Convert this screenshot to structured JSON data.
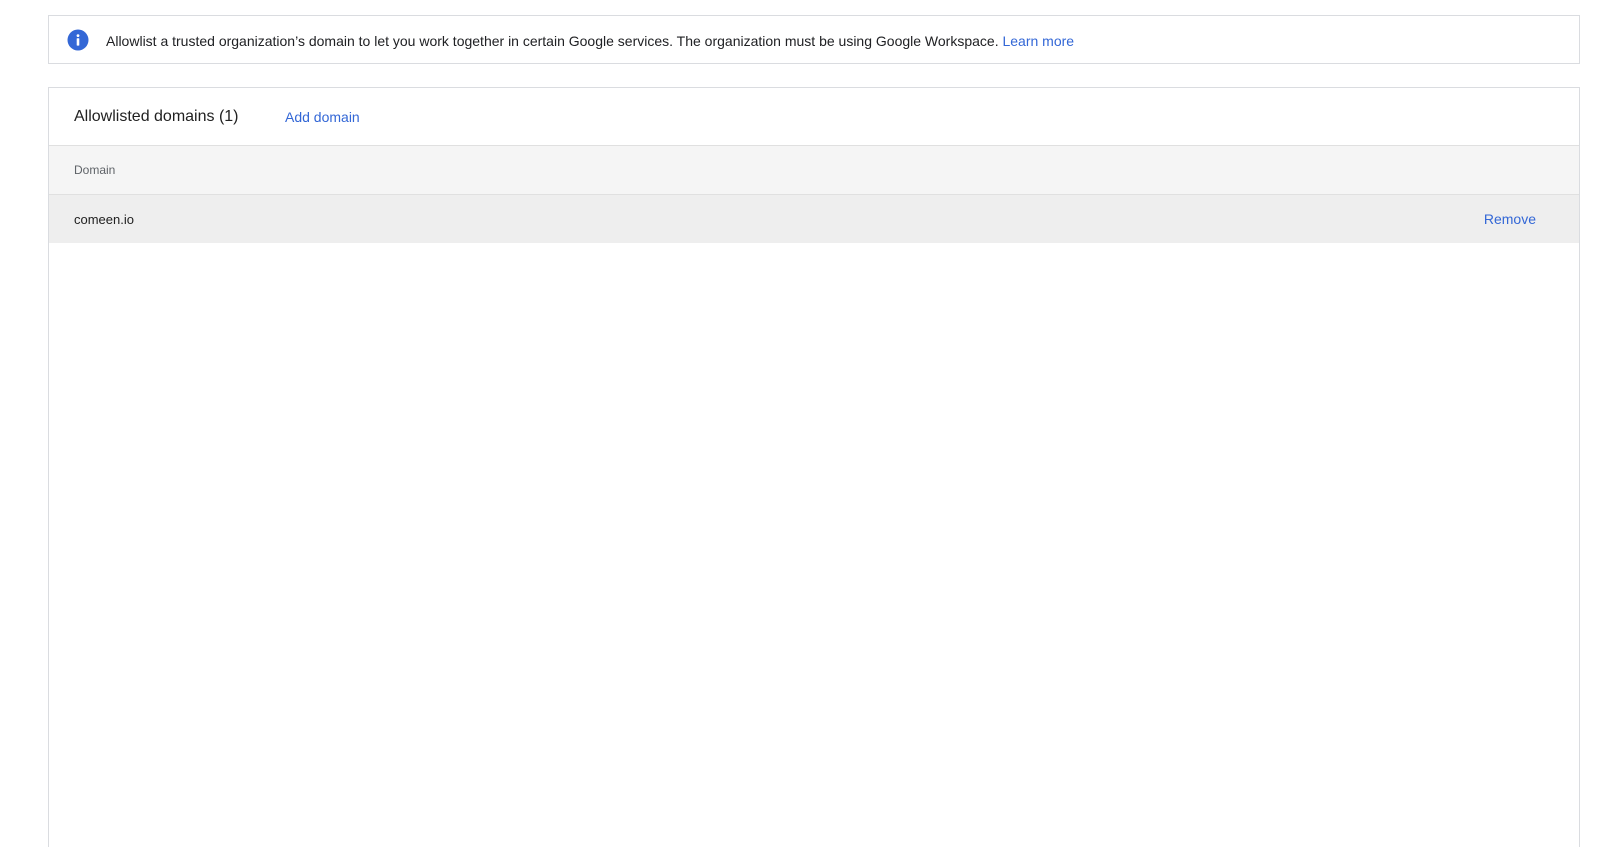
{
  "info_banner": {
    "icon": "info-icon",
    "text": "Allowlist a trusted organization’s domain to let you work together in certain Google services. The organization must be using Google Workspace.",
    "link_label": "Learn more"
  },
  "allowlist": {
    "title": "Allowlisted domains (1)",
    "add_label": "Add domain",
    "columns": [
      "Domain"
    ],
    "rows": [
      {
        "domain": "comeen.io",
        "action_label": "Remove"
      }
    ]
  },
  "colors": {
    "accent": "#3367d6",
    "info_icon": "#3367d6",
    "header_bg": "#f5f5f5",
    "row_bg": "#eeeeee",
    "border": "#dadce0"
  }
}
